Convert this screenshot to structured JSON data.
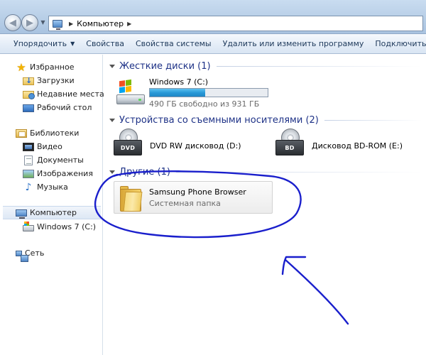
{
  "window": {
    "breadcrumb": "Компьютер"
  },
  "toolbar": {
    "items": [
      {
        "label": "Упорядочить",
        "has_dropdown": true
      },
      {
        "label": "Свойства"
      },
      {
        "label": "Свойства системы"
      },
      {
        "label": "Удалить или изменить программу"
      },
      {
        "label": "Подключить сетевой"
      }
    ]
  },
  "sidebar": {
    "favorites": {
      "label": "Избранное",
      "items": [
        {
          "label": "Загрузки",
          "icon": "download-folder-icon"
        },
        {
          "label": "Недавние места",
          "icon": "recent-places-icon"
        },
        {
          "label": "Рабочий стол",
          "icon": "desktop-icon"
        }
      ]
    },
    "libraries": {
      "label": "Библиотеки",
      "items": [
        {
          "label": "Видео",
          "icon": "video-library-icon"
        },
        {
          "label": "Документы",
          "icon": "documents-library-icon"
        },
        {
          "label": "Изображения",
          "icon": "pictures-library-icon"
        },
        {
          "label": "Музыка",
          "icon": "music-library-icon"
        }
      ]
    },
    "computer": {
      "label": "Компьютер",
      "selected": true,
      "items": [
        {
          "label": "Windows 7 (C:)",
          "icon": "drive-icon"
        }
      ]
    },
    "network": {
      "label": "Сеть"
    }
  },
  "main": {
    "groups": [
      {
        "title": "Жесткие диски (1)"
      },
      {
        "title": "Устройства со съемными носителями (2)"
      },
      {
        "title": "Другие (1)"
      }
    ],
    "hard_drive": {
      "name": "Windows 7 (C:)",
      "free_text": "490 ГБ свободно из 931 ГБ",
      "used_fraction": 0.47
    },
    "removable": [
      {
        "name": "DVD RW дисковод (D:)",
        "badge": "DVD"
      },
      {
        "name": "Дисковод BD-ROM (E:)",
        "badge": "BD"
      }
    ],
    "other": {
      "name": "Samsung Phone Browser",
      "type": "Системная папка"
    }
  },
  "colors": {
    "group_title": "#1e3287",
    "annotation": "#1a1fcc",
    "bar_fill": "#2a9ad8"
  }
}
